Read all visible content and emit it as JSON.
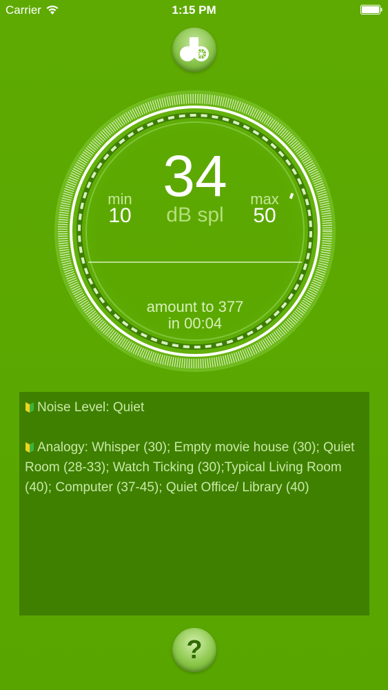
{
  "status_bar": {
    "carrier": "Carrier",
    "time": "1:15 PM"
  },
  "meter": {
    "value": "34",
    "unit": "dB spl",
    "min_label": "min",
    "min_value": "10",
    "max_label": "max",
    "max_value": "50",
    "amount_line1": "amount to 377",
    "amount_line2": "in 00:04"
  },
  "info": {
    "noise_level": "Noise Level: Quiet",
    "analogy": "Analogy: Whisper (30); Empty movie house (30); Quiet Room (28-33); Watch Ticking (30);Typical Living Room (40); Computer (37-45); Quiet Office/ Library (40)"
  },
  "help": {
    "label": "?"
  },
  "colors": {
    "background": "#5aa800",
    "panel": "#3f8000",
    "panel_text": "#c9e9a6"
  }
}
